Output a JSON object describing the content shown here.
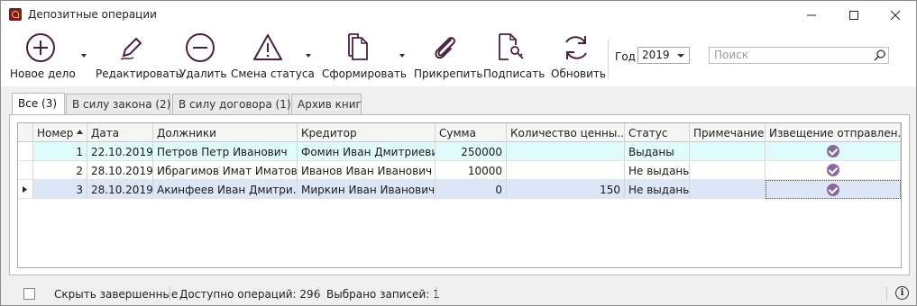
{
  "window": {
    "title": "Депозитные операции"
  },
  "toolbar": {
    "new": "Новое дело",
    "edit": "Редактировать",
    "delete": "Удалить",
    "status": "Смена статуса",
    "form": "Сформировать",
    "attach": "Прикрепить",
    "sign": "Подписать",
    "refresh": "Обновить",
    "year_label": "Год",
    "year_value": "2019",
    "search_placeholder": "Поиск"
  },
  "tabs": [
    "Все (3)",
    "В силу закона (2)",
    "В силу договора (1)",
    "Архив книг"
  ],
  "table": {
    "columns": [
      "Номер",
      "Дата",
      "Должники",
      "Кредитор",
      "Сумма",
      "Количество ценны...",
      "Статус",
      "Примечание",
      "Извещение отправлен..."
    ],
    "rows": [
      {
        "num": "1",
        "date": "22.10.2019",
        "debtor": "Петров Петр Иванович",
        "creditor": "Фомин Иван Дмитриевич",
        "sum": "250000",
        "qty": "",
        "status": "Выданы",
        "note": "",
        "notice": true
      },
      {
        "num": "2",
        "date": "28.10.2019",
        "debtor": "Ибрагимов Имат Иматович",
        "creditor": "Иванов Иван Иванович",
        "sum": "10000",
        "qty": "",
        "status": "Не выданы",
        "note": "",
        "notice": true
      },
      {
        "num": "3",
        "date": "28.10.2019",
        "debtor": "Акинфеев Иван Дмитри...",
        "creditor": "Миркин Иван Иванович",
        "sum": "0",
        "qty": "150",
        "status": "Не выданы",
        "note": "",
        "notice": true
      }
    ]
  },
  "statusbar": {
    "hide_completed": "Скрыть завершенные",
    "available": "Доступно операций: 296",
    "selected": "Выбрано записей: 1"
  },
  "colors": {
    "accent": "#5a2a4a",
    "row_highlight": "#e0fbfb",
    "row_selected": "#dde6f7"
  }
}
